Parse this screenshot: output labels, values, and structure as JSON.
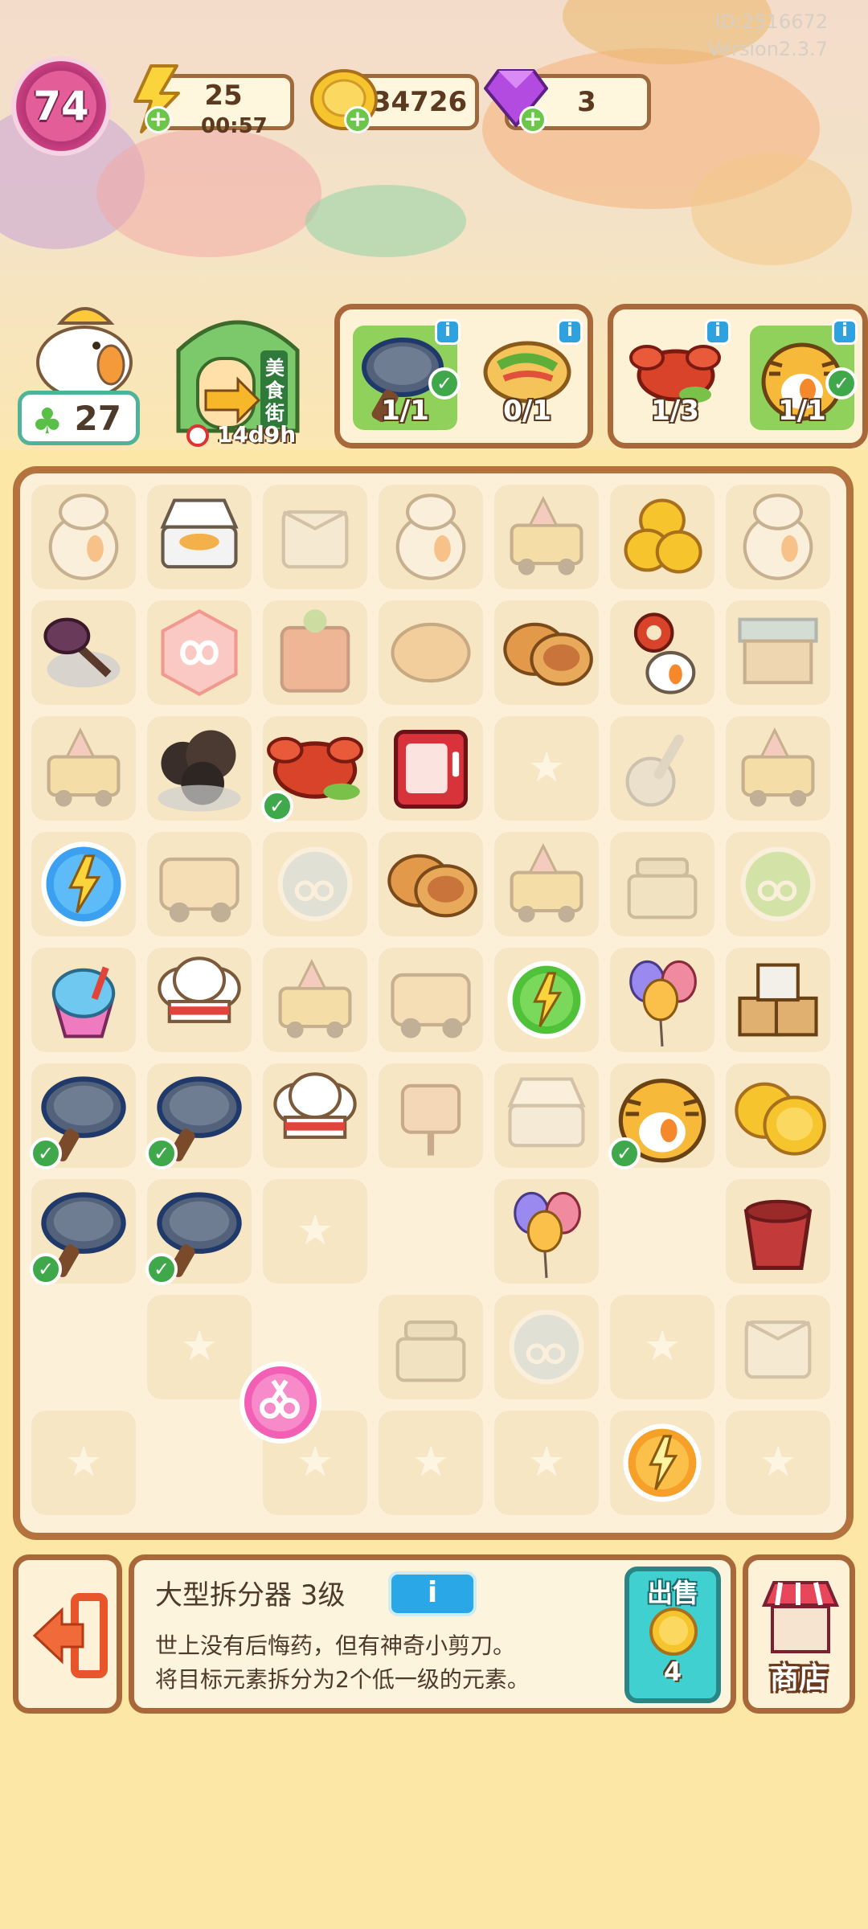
{
  "header": {
    "player_id": "ID:2516672",
    "version": "Version2.3.7",
    "level": "74",
    "energy": {
      "value": "25",
      "timer": "00:57"
    },
    "coins": {
      "value": "34726"
    },
    "gems": {
      "value": "3"
    }
  },
  "characters": {
    "clover_count": "27",
    "shop_sign": "美食街",
    "shop_timer": "14d9h"
  },
  "orders": [
    {
      "name": "frying-pan",
      "progress": "1/1",
      "complete": true
    },
    {
      "name": "burrito",
      "progress": "0/1",
      "complete": false
    },
    {
      "name": "lobster",
      "progress": "1/3",
      "complete": false
    },
    {
      "name": "tiger-chick",
      "progress": "1/1",
      "complete": true
    }
  ],
  "board": {
    "cols": 7,
    "rows": 9,
    "cells": [
      [
        "chick-chef-faded",
        "lunchbox",
        "box-faded",
        "chick-chef-faded",
        "cart-faded",
        "coins",
        "chick-chef-faded"
      ],
      [
        "witch-broom-web",
        "infinity-tile",
        "stove-faded",
        "pancakes-faded",
        "pancakes",
        "key-chick",
        "stall-faded"
      ],
      [
        "cart-faded",
        "smoke-web",
        "lobster",
        "red-fridge",
        "empty",
        "ladle-faded",
        "cart-faded"
      ],
      [
        "energy-blue",
        "truck-faded",
        "scissors-faded",
        "pancakes",
        "cart-faded",
        "scale-faded",
        "scissors-green-faded"
      ],
      [
        "shaved-ice",
        "chef-hat",
        "cart-faded",
        "truck-faded",
        "energy-green",
        "balloons",
        "boxes"
      ],
      [
        "frying-pan",
        "frying-pan",
        "chef-hat",
        "sign-faded",
        "lunchbox-faded",
        "tiger-chick",
        "coins-big"
      ],
      [
        "frying-pan",
        "frying-pan",
        "empty",
        "blank",
        "balloons",
        "blank",
        "bucket"
      ],
      [
        "blank",
        "empty",
        "blank",
        "scale-faded",
        "scissors-faded",
        "empty",
        "box-faded"
      ],
      [
        "empty",
        "blank",
        "empty",
        "empty",
        "empty",
        "energy-orange",
        "empty"
      ]
    ],
    "checked": [
      [
        2,
        2
      ],
      [
        5,
        0
      ],
      [
        5,
        1
      ],
      [
        5,
        5
      ],
      [
        6,
        0
      ],
      [
        6,
        1
      ]
    ],
    "floating_item": "scissors-pink"
  },
  "selected": {
    "title": "大型拆分器 3级",
    "info_label": "i",
    "description_line1": "世上没有后悔药，但有神奇小剪刀。",
    "description_line2": "将目标元素拆分为2个低一级的元素。",
    "sell_label": "出售",
    "sell_price": "4"
  },
  "buttons": {
    "shop_label": "商店"
  },
  "colors": {
    "board_border": "#b4733e",
    "cell_bg": "#f7e6c4",
    "sell_teal": "#3fd0cf",
    "info_blue": "#29a7e6",
    "check_green": "#3fa84a"
  }
}
